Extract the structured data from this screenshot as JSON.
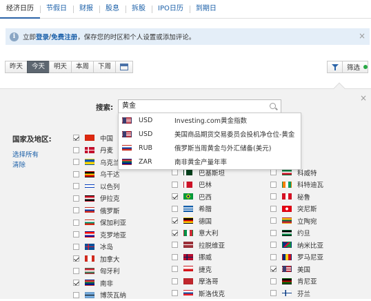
{
  "tabs": [
    "经济日历",
    "节假日",
    "财报",
    "股息",
    "拆股",
    "IPO日历",
    "到期日"
  ],
  "notice": {
    "prefix": "立即",
    "login": "登录",
    "sep": " / ",
    "register": "免费注册",
    "suffix": "，保存您的时区和个人设置或添加评论。",
    "close": "×"
  },
  "day_buttons": [
    "昨天",
    "今天",
    "明天",
    "本周",
    "下周"
  ],
  "filter": {
    "label": "筛选"
  },
  "panel": {
    "close": "×"
  },
  "search": {
    "label": "搜索:",
    "value": "黄金"
  },
  "suggestions": [
    {
      "cur": "USD",
      "text": "Investing.com黄金指数",
      "flag": "us"
    },
    {
      "cur": "USD",
      "text": "美国商品期货交易委员会投机净仓位-黄金",
      "flag": "us"
    },
    {
      "cur": "RUB",
      "text": "俄罗斯当周黄金与外汇储备(美元)",
      "flag": "ru"
    },
    {
      "cur": "ZAR",
      "text": "南非黄金产量年率",
      "flag": "za"
    }
  ],
  "countries": {
    "label": "国家及地区:",
    "select_all": "选择所有",
    "clear": "清除"
  },
  "col1": [
    {
      "name": "中国",
      "on": true,
      "flag": "cn"
    },
    {
      "name": "丹麦",
      "on": false,
      "flag": "dk"
    },
    {
      "name": "乌克兰",
      "on": false,
      "flag": "ua"
    },
    {
      "name": "乌干达",
      "on": false,
      "flag": "ug"
    },
    {
      "name": "以色列",
      "on": false,
      "flag": "il"
    },
    {
      "name": "伊拉克",
      "on": false,
      "flag": "iq"
    },
    {
      "name": "俄罗斯",
      "on": false,
      "flag": "ru"
    },
    {
      "name": "保加利亚",
      "on": false,
      "flag": "bg"
    },
    {
      "name": "克罗地亚",
      "on": false,
      "flag": "hr"
    },
    {
      "name": "冰岛",
      "on": false,
      "flag": "is"
    },
    {
      "name": "加拿大",
      "on": true,
      "flag": "ca"
    },
    {
      "name": "匈牙利",
      "on": false,
      "flag": "hu"
    },
    {
      "name": "南非",
      "on": true,
      "flag": "za"
    },
    {
      "name": "博茨瓦纳",
      "on": false,
      "flag": "bw"
    }
  ],
  "col2": [
    {
      "name": "巴基斯坦",
      "on": false,
      "flag": "pk"
    },
    {
      "name": "巴林",
      "on": false,
      "flag": "bh"
    },
    {
      "name": "巴西",
      "on": true,
      "flag": "br"
    },
    {
      "name": "希腊",
      "on": false,
      "flag": "gr"
    },
    {
      "name": "德国",
      "on": true,
      "flag": "de"
    },
    {
      "name": "意大利",
      "on": true,
      "flag": "it"
    },
    {
      "name": "拉脱维亚",
      "on": false,
      "flag": "lv"
    },
    {
      "name": "挪威",
      "on": false,
      "flag": "no"
    },
    {
      "name": "捷克",
      "on": false,
      "flag": "cz"
    },
    {
      "name": "摩洛哥",
      "on": false,
      "flag": "ma"
    },
    {
      "name": "斯洛伐克",
      "on": false,
      "flag": "sk"
    }
  ],
  "col3": [
    {
      "name": "科威特",
      "on": false,
      "flag": "kw"
    },
    {
      "name": "科特迪瓦",
      "on": false,
      "flag": "ci"
    },
    {
      "name": "秘鲁",
      "on": false,
      "flag": "pe"
    },
    {
      "name": "突尼斯",
      "on": false,
      "flag": "tn"
    },
    {
      "name": "立陶宛",
      "on": false,
      "flag": "lt"
    },
    {
      "name": "约旦",
      "on": false,
      "flag": "jo"
    },
    {
      "name": "纳米比亚",
      "on": false,
      "flag": "na"
    },
    {
      "name": "罗马尼亚",
      "on": false,
      "flag": "ro"
    },
    {
      "name": "美国",
      "on": true,
      "flag": "us"
    },
    {
      "name": "肯尼亚",
      "on": false,
      "flag": "ke"
    },
    {
      "name": "芬兰",
      "on": false,
      "flag": "fi"
    }
  ]
}
